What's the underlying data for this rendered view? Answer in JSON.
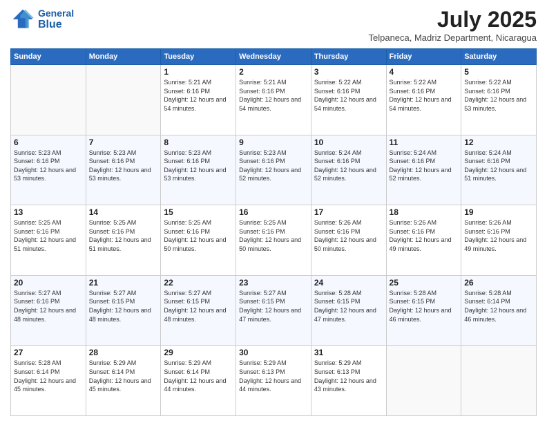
{
  "header": {
    "logo_general": "General",
    "logo_blue": "Blue",
    "month_title": "July 2025",
    "location": "Telpaneca, Madriz Department, Nicaragua"
  },
  "weekdays": [
    "Sunday",
    "Monday",
    "Tuesday",
    "Wednesday",
    "Thursday",
    "Friday",
    "Saturday"
  ],
  "weeks": [
    [
      {
        "day": "",
        "sunrise": "",
        "sunset": "",
        "daylight": ""
      },
      {
        "day": "",
        "sunrise": "",
        "sunset": "",
        "daylight": ""
      },
      {
        "day": "1",
        "sunrise": "Sunrise: 5:21 AM",
        "sunset": "Sunset: 6:16 PM",
        "daylight": "Daylight: 12 hours and 54 minutes."
      },
      {
        "day": "2",
        "sunrise": "Sunrise: 5:21 AM",
        "sunset": "Sunset: 6:16 PM",
        "daylight": "Daylight: 12 hours and 54 minutes."
      },
      {
        "day": "3",
        "sunrise": "Sunrise: 5:22 AM",
        "sunset": "Sunset: 6:16 PM",
        "daylight": "Daylight: 12 hours and 54 minutes."
      },
      {
        "day": "4",
        "sunrise": "Sunrise: 5:22 AM",
        "sunset": "Sunset: 6:16 PM",
        "daylight": "Daylight: 12 hours and 54 minutes."
      },
      {
        "day": "5",
        "sunrise": "Sunrise: 5:22 AM",
        "sunset": "Sunset: 6:16 PM",
        "daylight": "Daylight: 12 hours and 53 minutes."
      }
    ],
    [
      {
        "day": "6",
        "sunrise": "Sunrise: 5:23 AM",
        "sunset": "Sunset: 6:16 PM",
        "daylight": "Daylight: 12 hours and 53 minutes."
      },
      {
        "day": "7",
        "sunrise": "Sunrise: 5:23 AM",
        "sunset": "Sunset: 6:16 PM",
        "daylight": "Daylight: 12 hours and 53 minutes."
      },
      {
        "day": "8",
        "sunrise": "Sunrise: 5:23 AM",
        "sunset": "Sunset: 6:16 PM",
        "daylight": "Daylight: 12 hours and 53 minutes."
      },
      {
        "day": "9",
        "sunrise": "Sunrise: 5:23 AM",
        "sunset": "Sunset: 6:16 PM",
        "daylight": "Daylight: 12 hours and 52 minutes."
      },
      {
        "day": "10",
        "sunrise": "Sunrise: 5:24 AM",
        "sunset": "Sunset: 6:16 PM",
        "daylight": "Daylight: 12 hours and 52 minutes."
      },
      {
        "day": "11",
        "sunrise": "Sunrise: 5:24 AM",
        "sunset": "Sunset: 6:16 PM",
        "daylight": "Daylight: 12 hours and 52 minutes."
      },
      {
        "day": "12",
        "sunrise": "Sunrise: 5:24 AM",
        "sunset": "Sunset: 6:16 PM",
        "daylight": "Daylight: 12 hours and 51 minutes."
      }
    ],
    [
      {
        "day": "13",
        "sunrise": "Sunrise: 5:25 AM",
        "sunset": "Sunset: 6:16 PM",
        "daylight": "Daylight: 12 hours and 51 minutes."
      },
      {
        "day": "14",
        "sunrise": "Sunrise: 5:25 AM",
        "sunset": "Sunset: 6:16 PM",
        "daylight": "Daylight: 12 hours and 51 minutes."
      },
      {
        "day": "15",
        "sunrise": "Sunrise: 5:25 AM",
        "sunset": "Sunset: 6:16 PM",
        "daylight": "Daylight: 12 hours and 50 minutes."
      },
      {
        "day": "16",
        "sunrise": "Sunrise: 5:25 AM",
        "sunset": "Sunset: 6:16 PM",
        "daylight": "Daylight: 12 hours and 50 minutes."
      },
      {
        "day": "17",
        "sunrise": "Sunrise: 5:26 AM",
        "sunset": "Sunset: 6:16 PM",
        "daylight": "Daylight: 12 hours and 50 minutes."
      },
      {
        "day": "18",
        "sunrise": "Sunrise: 5:26 AM",
        "sunset": "Sunset: 6:16 PM",
        "daylight": "Daylight: 12 hours and 49 minutes."
      },
      {
        "day": "19",
        "sunrise": "Sunrise: 5:26 AM",
        "sunset": "Sunset: 6:16 PM",
        "daylight": "Daylight: 12 hours and 49 minutes."
      }
    ],
    [
      {
        "day": "20",
        "sunrise": "Sunrise: 5:27 AM",
        "sunset": "Sunset: 6:16 PM",
        "daylight": "Daylight: 12 hours and 48 minutes."
      },
      {
        "day": "21",
        "sunrise": "Sunrise: 5:27 AM",
        "sunset": "Sunset: 6:15 PM",
        "daylight": "Daylight: 12 hours and 48 minutes."
      },
      {
        "day": "22",
        "sunrise": "Sunrise: 5:27 AM",
        "sunset": "Sunset: 6:15 PM",
        "daylight": "Daylight: 12 hours and 48 minutes."
      },
      {
        "day": "23",
        "sunrise": "Sunrise: 5:27 AM",
        "sunset": "Sunset: 6:15 PM",
        "daylight": "Daylight: 12 hours and 47 minutes."
      },
      {
        "day": "24",
        "sunrise": "Sunrise: 5:28 AM",
        "sunset": "Sunset: 6:15 PM",
        "daylight": "Daylight: 12 hours and 47 minutes."
      },
      {
        "day": "25",
        "sunrise": "Sunrise: 5:28 AM",
        "sunset": "Sunset: 6:15 PM",
        "daylight": "Daylight: 12 hours and 46 minutes."
      },
      {
        "day": "26",
        "sunrise": "Sunrise: 5:28 AM",
        "sunset": "Sunset: 6:14 PM",
        "daylight": "Daylight: 12 hours and 46 minutes."
      }
    ],
    [
      {
        "day": "27",
        "sunrise": "Sunrise: 5:28 AM",
        "sunset": "Sunset: 6:14 PM",
        "daylight": "Daylight: 12 hours and 45 minutes."
      },
      {
        "day": "28",
        "sunrise": "Sunrise: 5:29 AM",
        "sunset": "Sunset: 6:14 PM",
        "daylight": "Daylight: 12 hours and 45 minutes."
      },
      {
        "day": "29",
        "sunrise": "Sunrise: 5:29 AM",
        "sunset": "Sunset: 6:14 PM",
        "daylight": "Daylight: 12 hours and 44 minutes."
      },
      {
        "day": "30",
        "sunrise": "Sunrise: 5:29 AM",
        "sunset": "Sunset: 6:13 PM",
        "daylight": "Daylight: 12 hours and 44 minutes."
      },
      {
        "day": "31",
        "sunrise": "Sunrise: 5:29 AM",
        "sunset": "Sunset: 6:13 PM",
        "daylight": "Daylight: 12 hours and 43 minutes."
      },
      {
        "day": "",
        "sunrise": "",
        "sunset": "",
        "daylight": ""
      },
      {
        "day": "",
        "sunrise": "",
        "sunset": "",
        "daylight": ""
      }
    ]
  ]
}
